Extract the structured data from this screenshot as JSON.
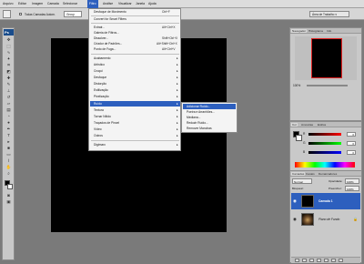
{
  "menubar": {
    "items": [
      "Arquivo",
      "Editar",
      "Imagem",
      "Camada",
      "Selecionar",
      "Filtro",
      "Análise",
      "Visualizar",
      "Janela",
      "Ajuda"
    ],
    "active_index": 5
  },
  "optionsbar": {
    "checkbox_label": "Todas Camadas Autom.",
    "select_value": "Group",
    "workspace_label": "Área de Trabalho ▾"
  },
  "canvas": {
    "background_color": "#000000"
  },
  "filter_menu": {
    "items": [
      {
        "label": "Desfoque de Movimento",
        "shortcut": "Ctrl+F",
        "arrow": ""
      },
      {
        "label": "Convert for Smart Filters",
        "shortcut": "",
        "arrow": ""
      },
      {
        "label": "Extrair...",
        "shortcut": "Alt+Ctrl+X",
        "arrow": ""
      },
      {
        "label": "Galeria de Filtros...",
        "shortcut": "",
        "arrow": ""
      },
      {
        "label": "Dissolver...",
        "shortcut": "Shift+Ctrl+X",
        "arrow": ""
      },
      {
        "label": "Criador de Padrões...",
        "shortcut": "Alt+Shift+Ctrl+X",
        "arrow": ""
      },
      {
        "label": "Ponto de Fuga...",
        "shortcut": "Alt+Ctrl+V",
        "arrow": ""
      },
      {
        "label": "Acabamento",
        "shortcut": "",
        "arrow": "▸"
      },
      {
        "label": "Artístico",
        "shortcut": "",
        "arrow": "▸"
      },
      {
        "label": "Croqui",
        "shortcut": "",
        "arrow": "▸"
      },
      {
        "label": "Desfoque",
        "shortcut": "",
        "arrow": "▸"
      },
      {
        "label": "Distorção",
        "shortcut": "",
        "arrow": "▸"
      },
      {
        "label": "Estilização",
        "shortcut": "",
        "arrow": "▸"
      },
      {
        "label": "Pixelização",
        "shortcut": "",
        "arrow": "▸"
      },
      {
        "label": "Ruído",
        "shortcut": "",
        "arrow": "▸"
      },
      {
        "label": "Textura",
        "shortcut": "",
        "arrow": "▸"
      },
      {
        "label": "Tornar Nítido",
        "shortcut": "",
        "arrow": "▸"
      },
      {
        "label": "Traçados de Pincel",
        "shortcut": "",
        "arrow": "▸"
      },
      {
        "label": "Vídeo",
        "shortcut": "",
        "arrow": "▸"
      },
      {
        "label": "Outros",
        "shortcut": "",
        "arrow": "▸"
      },
      {
        "label": "Digimarc",
        "shortcut": "",
        "arrow": "▸"
      }
    ]
  },
  "noise_submenu": {
    "items": [
      "Adicionar Ruído...",
      "Poeira e Arranhões...",
      "Mediana...",
      "Reduzir Ruído...",
      "Remover Manchas"
    ]
  },
  "navigator_panel": {
    "tabs": [
      "Navegador",
      "Histograma",
      "Info"
    ],
    "zoom": "100%"
  },
  "color_panel": {
    "tabs": [
      "Cor",
      "Amostras",
      "Estilos"
    ],
    "channels": [
      {
        "label": "R",
        "value": "0",
        "gradient": "linear-gradient(90deg,#000,#f00)"
      },
      {
        "label": "G",
        "value": "0",
        "gradient": "linear-gradient(90deg,#000,#0f0)"
      },
      {
        "label": "B",
        "value": "0",
        "gradient": "linear-gradient(90deg,#000,#00f)"
      }
    ]
  },
  "layers_panel": {
    "tabs": [
      "Camadas",
      "Canais",
      "Demarcadores"
    ],
    "blend_mode": "Normal",
    "opacity_label": "Opacidade:",
    "opacity_value": "100%",
    "lock_label": "Bloquear:",
    "fill_label": "Preencher:",
    "fill_value": "100%",
    "layers": [
      {
        "name": "Camada 1",
        "selected": true
      },
      {
        "name": "Plano de Fundo",
        "selected": false
      }
    ]
  },
  "colors": {
    "menu_highlight": "#2d5fbe",
    "canvas": "#000000",
    "navigator_frame": "#e02020"
  }
}
